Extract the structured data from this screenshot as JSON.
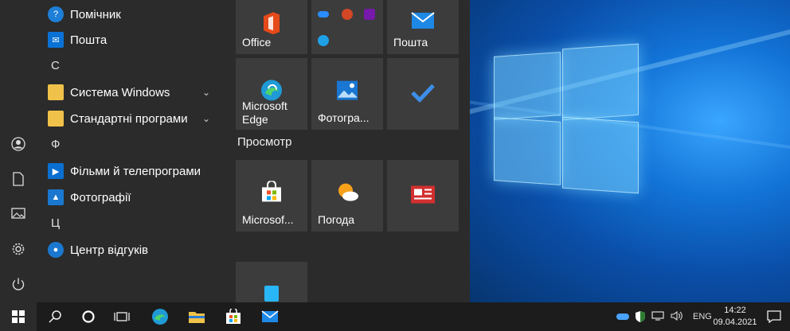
{
  "apps": {
    "helper": "Помічник",
    "mail": "Пошта",
    "letter_s": "С",
    "system_windows": "Система Windows",
    "standard_programs": "Стандартні програми",
    "letter_f": "Ф",
    "films_tv": "Фільми й телепрограми",
    "photos": "Фотографії",
    "letter_ts": "Ц",
    "feedback_hub": "Центр відгуків"
  },
  "tiles": {
    "office": "Office",
    "mail": "Пошта",
    "edge_line1": "Microsoft",
    "edge_line2": "Edge",
    "photos": "Фотогра...",
    "section_browse": "Просмотр",
    "store": "Microsof...",
    "weather": "Погода"
  },
  "tray": {
    "language": "ENG",
    "time": "14:22",
    "date": "09.04.2021"
  },
  "icons": {
    "rail": [
      "user-icon",
      "document-icon",
      "pictures-icon",
      "settings-icon",
      "power-icon"
    ],
    "taskbar": [
      "start-icon",
      "search-icon",
      "cortana-icon",
      "task-view-icon",
      "edge-icon",
      "file-explorer-icon",
      "store-icon",
      "mail-icon"
    ]
  },
  "colors": {
    "start_bg": "#2b2b2b",
    "tile_bg": "#3c3c3c",
    "taskbar_bg": "#1c1c1c",
    "accent": "#0078d7"
  }
}
